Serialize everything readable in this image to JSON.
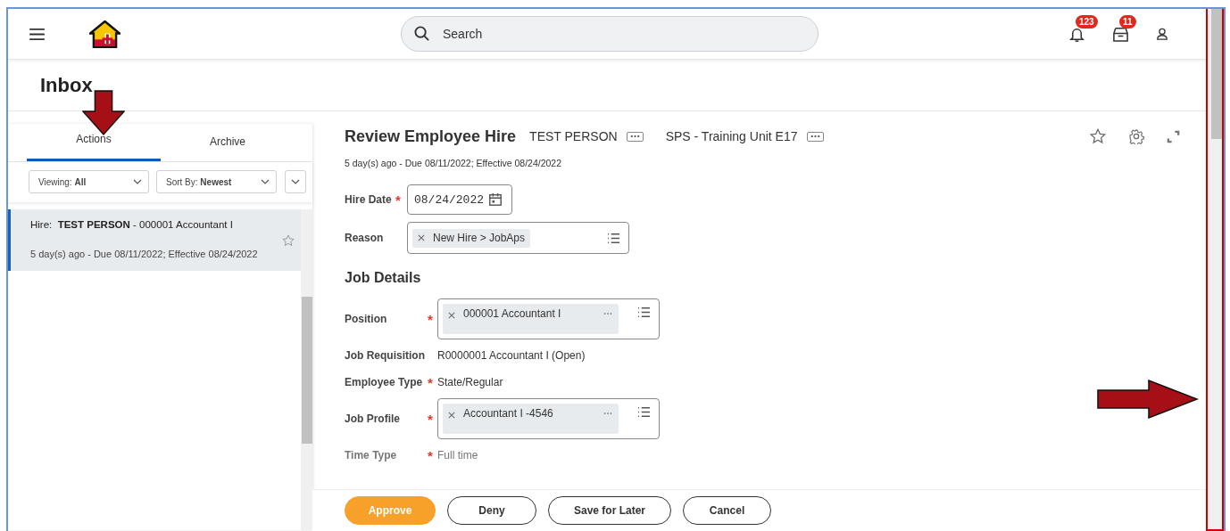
{
  "topbar": {
    "search": {
      "placeholder": "Search"
    },
    "notifications": {
      "badge": "123"
    },
    "inbox": {
      "badge": "11"
    }
  },
  "page_title": "Inbox",
  "required_symbol": "*",
  "tabs": [
    {
      "label": "Actions",
      "selected": true
    },
    {
      "label": "Archive",
      "selected": false
    }
  ],
  "filters": [
    {
      "label": "Viewing:",
      "value": "All"
    },
    {
      "label": "Sort By:",
      "value": "Newest"
    }
  ],
  "inbox_items": [
    {
      "title": "Hire:  **TEST PERSON** - 000001 Accountant I",
      "subtitle": "5 day(s) ago - Due 08/11/2022; Effective 08/24/2022",
      "selected": true
    }
  ],
  "task": {
    "title": "Review Employee Hire",
    "subject": "TEST PERSON",
    "organization": "SPS - Training Unit E17",
    "subtitle": "5 day(s) ago - Due 08/11/2022; Effective 08/24/2022"
  },
  "sections": [
    {
      "fields": [
        {
          "label": "Hire Date",
          "required": true,
          "kind": "date",
          "value": "08/24/2022"
        },
        {
          "label": "Reason",
          "required": false,
          "kind": "select",
          "chips": [
            "New Hire > JobAps"
          ]
        }
      ]
    },
    {
      "heading": "Job Details",
      "fields": [
        {
          "label": "Position",
          "required": true,
          "kind": "prompt",
          "chips": [
            "000001 Accountant I"
          ]
        },
        {
          "label": "Job Requisition",
          "required": false,
          "kind": "text",
          "value": "R0000001 Accountant I (Open)"
        },
        {
          "label": "Employee Type",
          "required": true,
          "kind": "text",
          "value": "State/Regular"
        },
        {
          "label": "Job Profile",
          "required": true,
          "kind": "prompt",
          "chips": [
            "Accountant I -4546"
          ]
        },
        {
          "label": "Time Type",
          "required": true,
          "kind": "text",
          "value": "Full time"
        }
      ]
    }
  ],
  "actions": [
    {
      "label": "Approve",
      "kind": "primary"
    },
    {
      "label": "Deny",
      "kind": "secondary"
    },
    {
      "label": "Save for Later",
      "kind": "secondary"
    },
    {
      "label": "Cancel",
      "kind": "secondary"
    }
  ]
}
